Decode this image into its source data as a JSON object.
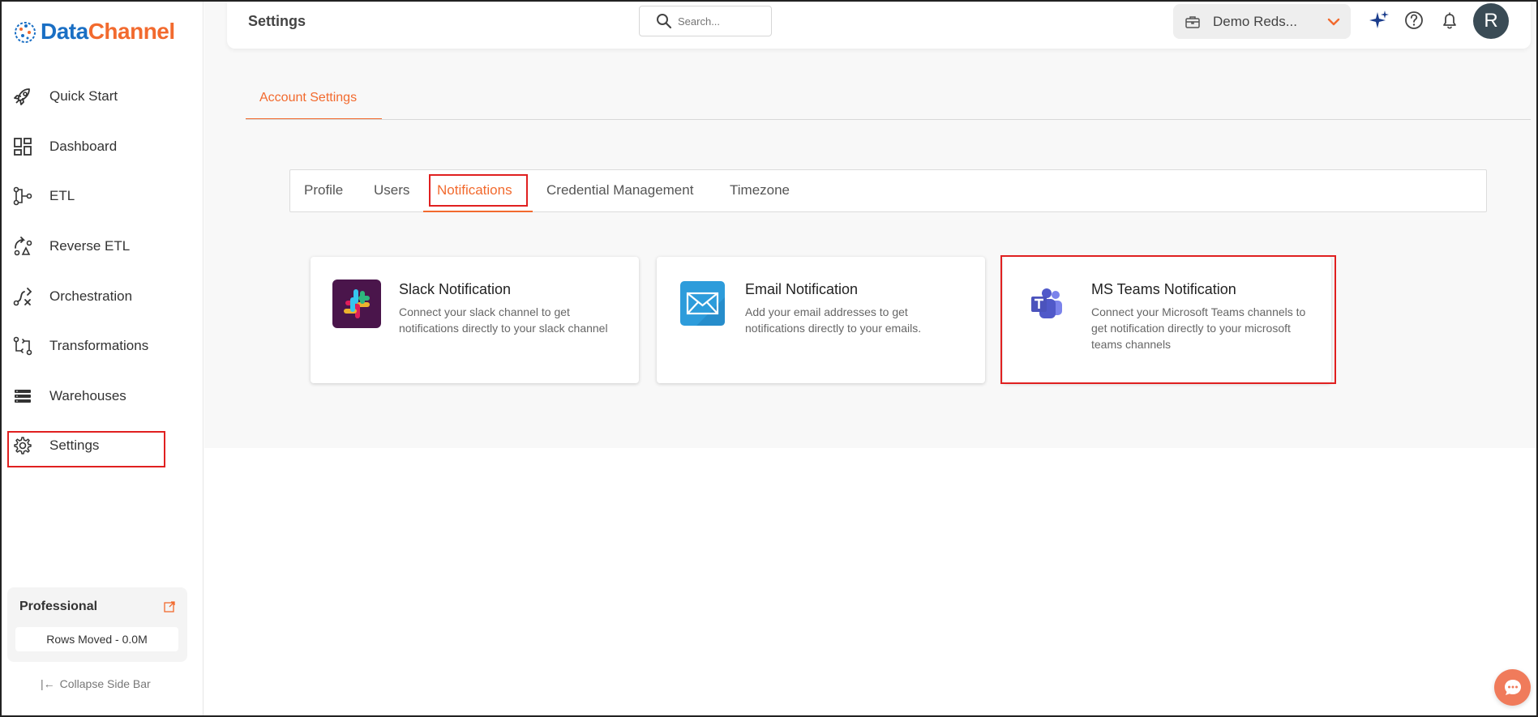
{
  "brand": {
    "name_part1": "Data",
    "name_part2": "Channel",
    "colors": {
      "primary_blue": "#1a6fc4",
      "accent_orange": "#f26a2e"
    }
  },
  "sidebar": {
    "items": [
      {
        "label": "Quick Start",
        "icon": "rocket-icon"
      },
      {
        "label": "Dashboard",
        "icon": "dashboard-grid-icon"
      },
      {
        "label": "ETL",
        "icon": "etl-flow-icon"
      },
      {
        "label": "Reverse ETL",
        "icon": "reverse-etl-icon"
      },
      {
        "label": "Orchestration",
        "icon": "orchestration-icon"
      },
      {
        "label": "Transformations",
        "icon": "transformations-icon"
      },
      {
        "label": "Warehouses",
        "icon": "warehouse-stack-icon"
      },
      {
        "label": "Settings",
        "icon": "gear-icon"
      }
    ],
    "plan": {
      "title": "Professional",
      "rows_moved": "Rows Moved - 0.0M"
    },
    "collapse_label": "Collapse Side Bar"
  },
  "header": {
    "title": "Settings",
    "search_placeholder": "Search...",
    "workspace": "Demo Reds...",
    "avatar_initial": "R"
  },
  "account_tab": "Account Settings",
  "subtabs": [
    {
      "label": "Profile",
      "active": false
    },
    {
      "label": "Users",
      "active": false
    },
    {
      "label": "Notifications",
      "active": true
    },
    {
      "label": "Credential Management",
      "active": false
    },
    {
      "label": "Timezone",
      "active": false
    }
  ],
  "cards": [
    {
      "title": "Slack Notification",
      "description": "Connect your slack channel to get notifications directly to your slack channel",
      "icon": "slack-icon"
    },
    {
      "title": "Email Notification",
      "description": "Add your email addresses to get notifications directly to your emails.",
      "icon": "email-icon"
    },
    {
      "title": "MS Teams Notification",
      "description": "Connect your Microsoft Teams channels to get notification directly to your microsoft teams channels",
      "icon": "ms-teams-icon"
    }
  ]
}
